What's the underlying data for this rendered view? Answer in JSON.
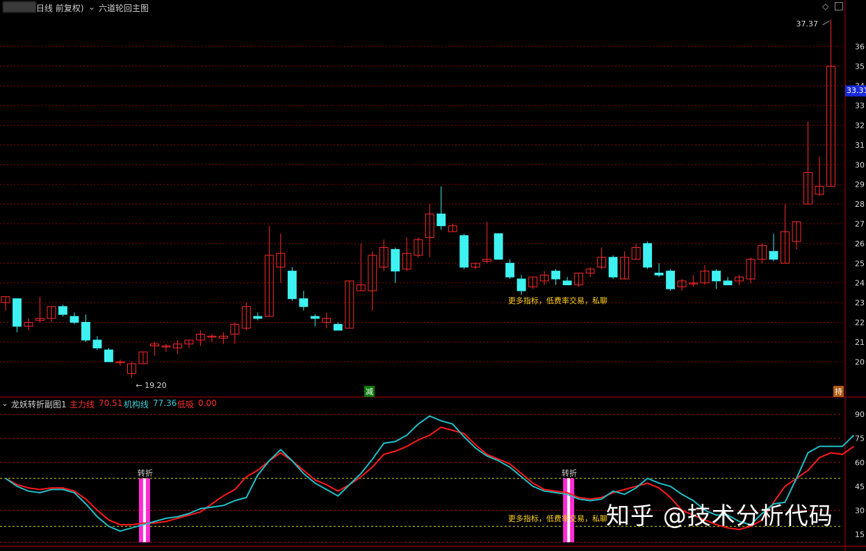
{
  "header": {
    "period": "日线 前复权)",
    "main_indicator": "六道轮回主图",
    "max_label": "37.37",
    "min_label": "19.20",
    "current_price": "33.31"
  },
  "sub_header": {
    "title": "龙妖转折副图1",
    "line1_name": "主力线",
    "line1_value": "70.51",
    "line2_name": "机构线",
    "line2_value": "77.36",
    "line3_name": "低吸",
    "line3_value": "0.00"
  },
  "annotations": {
    "promo_top": "更多指标，低费率交易，私聊",
    "promo_bottom": "更多指标，低费率交易，私聊",
    "turn_label": "转折",
    "marker_left": "减",
    "marker_right": "持"
  },
  "y_axis_main": [
    "36",
    "35",
    "34",
    "33",
    "32",
    "31",
    "30",
    "29",
    "28",
    "27",
    "26",
    "25",
    "24",
    "23",
    "22",
    "21",
    "20"
  ],
  "y_axis_sub": [
    "90",
    "75",
    "60",
    "45",
    "30",
    "15"
  ],
  "watermark": "知乎 @技术分析代码",
  "colors": {
    "up": "#ff2a2a",
    "down": "#3ff2f2",
    "grid": "#8a0000",
    "main_line": "#ff1a1a",
    "inst_line": "#20c0c8",
    "turn_bar": "#ff2bd6"
  },
  "chart_data": [
    {
      "type": "candlestick",
      "ylim": [
        19.2,
        37.37
      ],
      "candles": [
        [
          23.0,
          23.3,
          22.6,
          23.3
        ],
        [
          23.2,
          23.2,
          21.5,
          21.8
        ],
        [
          21.8,
          22.2,
          21.6,
          22.0
        ],
        [
          22.1,
          23.3,
          22.0,
          22.2
        ],
        [
          22.2,
          22.8,
          22.0,
          22.8
        ],
        [
          22.8,
          22.9,
          22.3,
          22.4
        ],
        [
          22.3,
          22.5,
          21.9,
          22.0
        ],
        [
          22.0,
          22.4,
          21.0,
          21.1
        ],
        [
          21.1,
          21.3,
          20.6,
          20.7
        ],
        [
          20.6,
          20.7,
          20.0,
          20.0
        ],
        [
          20.0,
          20.1,
          19.8,
          20.0
        ],
        [
          19.4,
          20.0,
          19.2,
          19.9
        ],
        [
          19.9,
          20.5,
          19.9,
          20.5
        ],
        [
          20.8,
          21.0,
          20.3,
          20.9
        ],
        [
          20.8,
          20.9,
          20.5,
          20.8
        ],
        [
          20.7,
          21.1,
          20.4,
          20.9
        ],
        [
          20.9,
          21.1,
          20.7,
          21.1
        ],
        [
          21.1,
          21.6,
          20.8,
          21.4
        ],
        [
          21.3,
          21.4,
          21.0,
          21.3
        ],
        [
          21.2,
          21.5,
          20.9,
          21.3
        ],
        [
          21.4,
          22.0,
          20.9,
          21.9
        ],
        [
          21.7,
          23.0,
          21.6,
          22.8
        ],
        [
          22.3,
          22.5,
          22.1,
          22.2
        ],
        [
          22.3,
          26.9,
          22.3,
          25.4
        ],
        [
          24.8,
          26.5,
          24.0,
          25.5
        ],
        [
          24.6,
          24.8,
          23.1,
          23.2
        ],
        [
          23.2,
          23.6,
          22.6,
          22.8
        ],
        [
          22.3,
          22.4,
          21.8,
          22.2
        ],
        [
          22.0,
          22.5,
          21.7,
          22.2
        ],
        [
          21.9,
          22.0,
          21.8,
          21.6
        ],
        [
          21.7,
          24.1,
          21.7,
          24.1
        ],
        [
          23.6,
          26.0,
          23.6,
          23.9
        ],
        [
          23.6,
          25.6,
          22.6,
          25.4
        ],
        [
          24.8,
          26.2,
          24.6,
          25.8
        ],
        [
          25.7,
          25.8,
          24.0,
          24.6
        ],
        [
          24.7,
          26.3,
          24.6,
          25.5
        ],
        [
          25.4,
          26.3,
          25.3,
          26.2
        ],
        [
          26.3,
          28.0,
          25.3,
          27.5
        ],
        [
          27.5,
          28.9,
          26.7,
          26.9
        ],
        [
          26.6,
          27.0,
          26.6,
          26.9
        ],
        [
          26.4,
          26.5,
          24.7,
          24.8
        ],
        [
          24.8,
          25.0,
          24.7,
          25.0
        ],
        [
          25.1,
          27.1,
          25.0,
          25.2
        ],
        [
          26.5,
          26.5,
          25.2,
          25.2
        ],
        [
          25.0,
          25.2,
          24.2,
          24.3
        ],
        [
          24.2,
          24.4,
          23.4,
          23.6
        ],
        [
          23.8,
          24.3,
          23.7,
          24.3
        ],
        [
          24.1,
          24.6,
          23.9,
          24.4
        ],
        [
          24.6,
          24.7,
          23.9,
          24.2
        ],
        [
          24.1,
          24.3,
          23.9,
          23.9
        ],
        [
          23.9,
          24.5,
          23.8,
          24.5
        ],
        [
          24.5,
          24.8,
          24.3,
          24.7
        ],
        [
          24.8,
          25.8,
          24.7,
          25.3
        ],
        [
          25.3,
          25.4,
          24.2,
          24.3
        ],
        [
          24.2,
          25.6,
          24.2,
          25.3
        ],
        [
          25.2,
          26.0,
          25.2,
          25.8
        ],
        [
          26.0,
          26.1,
          24.7,
          24.8
        ],
        [
          24.5,
          25.0,
          24.3,
          24.4
        ],
        [
          24.6,
          24.7,
          23.6,
          23.7
        ],
        [
          23.8,
          24.2,
          23.6,
          24.1
        ],
        [
          24.0,
          24.4,
          23.8,
          24.0
        ],
        [
          24.0,
          24.9,
          23.9,
          24.6
        ],
        [
          24.6,
          24.7,
          23.7,
          24.1
        ],
        [
          24.1,
          24.3,
          23.9,
          23.9
        ],
        [
          24.1,
          24.4,
          23.9,
          24.3
        ],
        [
          24.2,
          25.3,
          24.0,
          25.2
        ],
        [
          25.2,
          26.0,
          25.0,
          25.9
        ],
        [
          25.6,
          26.5,
          25.1,
          25.2
        ],
        [
          25.0,
          28.0,
          25.0,
          26.6
        ],
        [
          26.1,
          27.1,
          25.7,
          27.1
        ],
        [
          28.0,
          32.2,
          28.0,
          29.6
        ],
        [
          28.5,
          30.4,
          28.4,
          28.9
        ],
        [
          28.9,
          37.37,
          28.9,
          35.0
        ]
      ]
    },
    {
      "type": "line",
      "ylim": [
        8,
        94
      ],
      "series": [
        {
          "name": "主力线",
          "values": [
            50,
            46,
            44,
            43,
            44,
            44,
            42,
            37,
            30,
            24,
            21,
            21,
            22,
            22,
            23,
            25,
            27,
            29,
            34,
            39,
            43,
            51,
            55,
            61,
            66,
            61,
            55,
            49,
            46,
            42,
            46,
            51,
            57,
            65,
            67,
            70,
            74,
            77,
            82,
            80,
            78,
            71,
            65,
            62,
            59,
            53,
            47,
            43,
            42,
            41,
            38,
            37,
            38,
            41,
            43,
            45,
            47,
            44,
            38,
            30,
            27,
            24,
            21,
            19,
            18,
            20,
            24,
            35,
            45,
            50,
            55,
            63,
            66,
            65,
            70
          ]
        },
        {
          "name": "机构线",
          "values": [
            50,
            45,
            42,
            41,
            43,
            43,
            41,
            34,
            26,
            20,
            17,
            19,
            21,
            23,
            25,
            26,
            28,
            31,
            32,
            33,
            36,
            38,
            52,
            61,
            68,
            61,
            53,
            47,
            43,
            39,
            46,
            53,
            62,
            72,
            73,
            77,
            84,
            89,
            86,
            84,
            76,
            69,
            64,
            61,
            57,
            51,
            45,
            42,
            41,
            40,
            37,
            36,
            37,
            42,
            40,
            44,
            50,
            47,
            45,
            40,
            36,
            30,
            27,
            27,
            23,
            21,
            28,
            34,
            35,
            50,
            66,
            70,
            70,
            70,
            77
          ]
        }
      ]
    }
  ]
}
